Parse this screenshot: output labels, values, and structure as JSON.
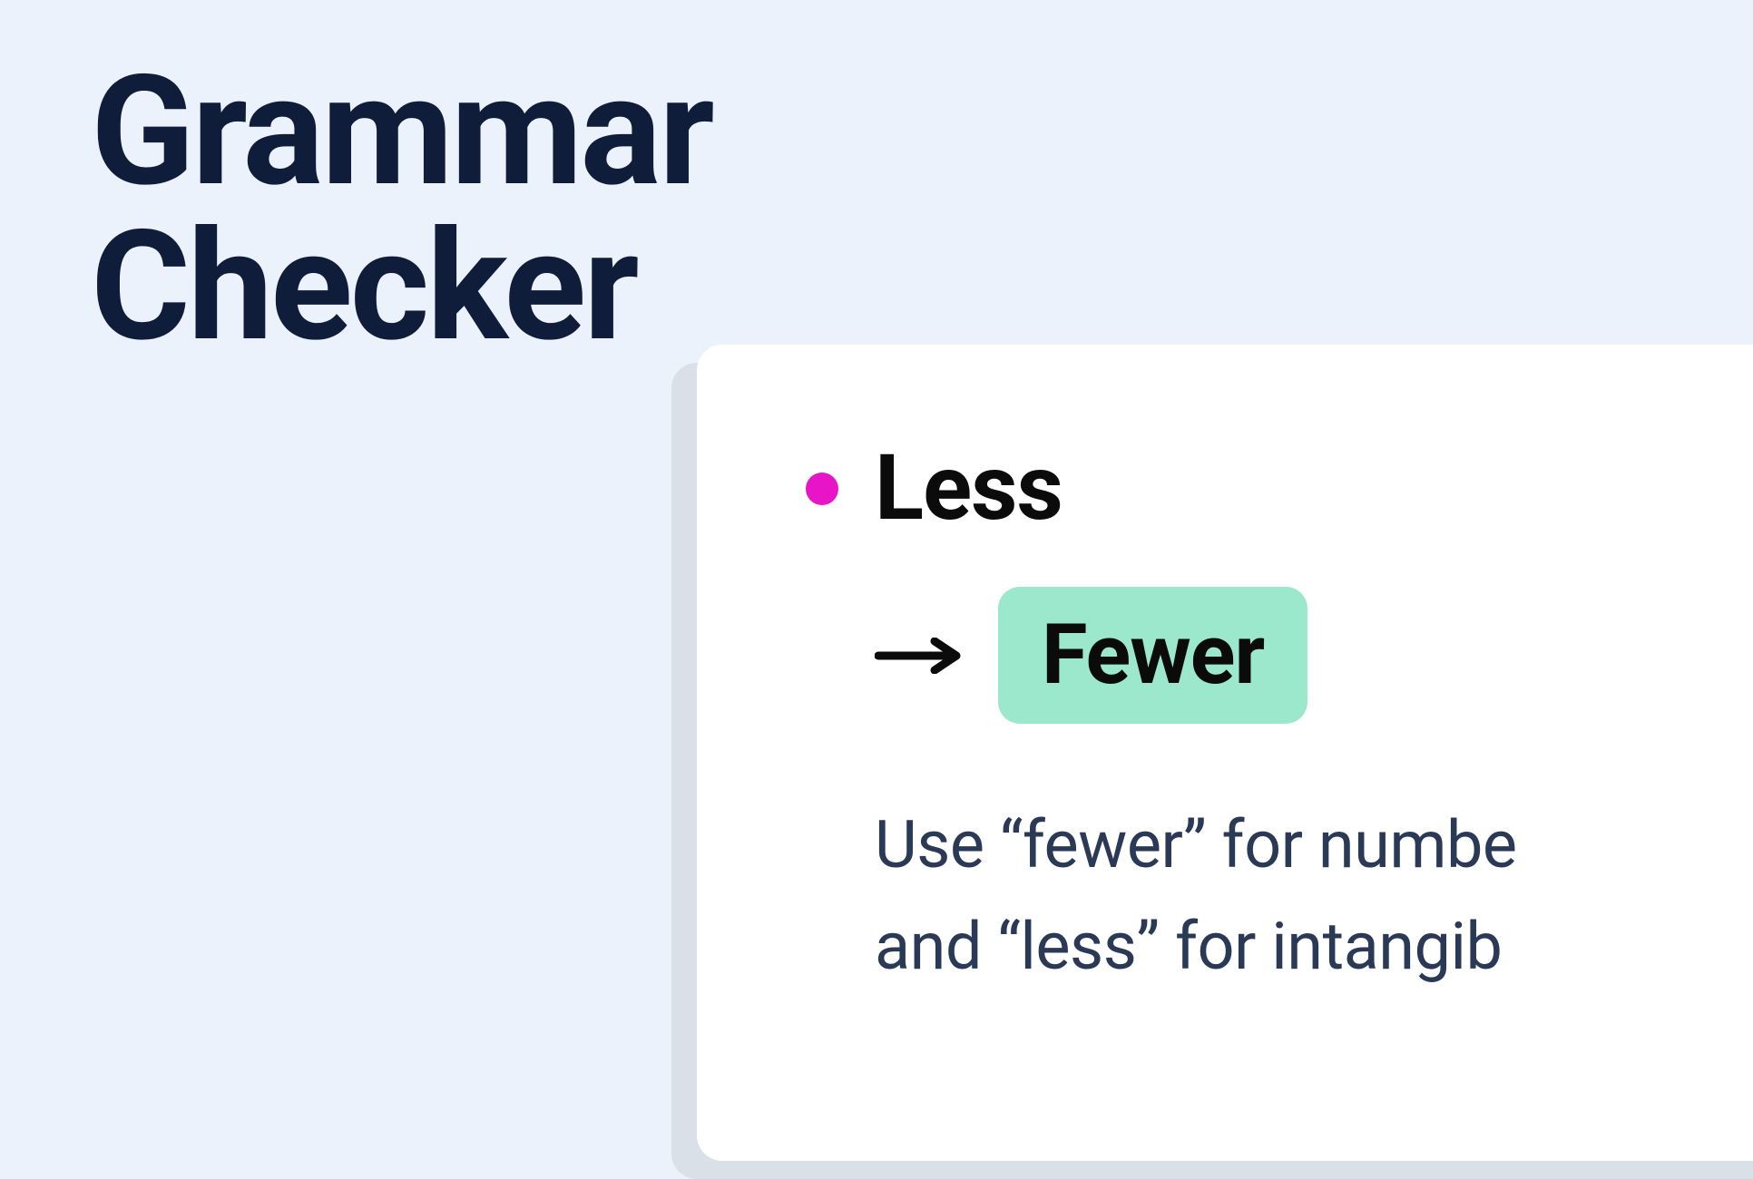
{
  "header": {
    "title_line1": "Grammar",
    "title_line2": "Checker"
  },
  "suggestion_card": {
    "dot_color": "#e815c8",
    "error_word": "Less",
    "suggested_word": "Fewer",
    "explanation_line1": "Use “fewer” for numbe",
    "explanation_line2": "and “less” for intangib"
  }
}
